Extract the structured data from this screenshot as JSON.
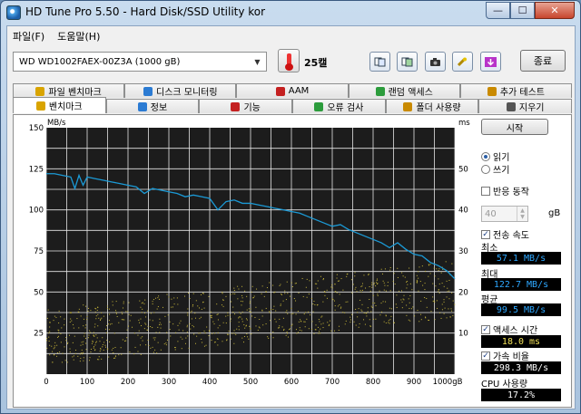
{
  "window": {
    "title": "HD Tune Pro 5.50 - Hard Disk/SSD Utility kor",
    "min": "—",
    "max": "☐",
    "close": "✕"
  },
  "menu": {
    "items": [
      "파일(F)",
      "도움말(H)"
    ]
  },
  "toolbar": {
    "drive": "WD    WD1002FAEX-00Z3A (1000 gB)",
    "temperature": "25캘",
    "exit_label": "종료",
    "buttons": [
      "copy-text-icon",
      "copy-image-icon",
      "screenshot-icon",
      "options-icon",
      "save-icon"
    ]
  },
  "tabs": {
    "top": [
      {
        "label": "파일 벤치마크",
        "icon": "file-benchmark-icon"
      },
      {
        "label": "디스크 모니터링",
        "icon": "disk-monitor-icon"
      },
      {
        "label": "AAM",
        "icon": "aam-icon"
      },
      {
        "label": "랜덤 액세스",
        "icon": "random-access-icon"
      },
      {
        "label": "추가 테스트",
        "icon": "extra-tests-icon"
      }
    ],
    "bottom": [
      {
        "label": "벤치마크",
        "icon": "benchmark-icon"
      },
      {
        "label": "정보",
        "icon": "info-icon"
      },
      {
        "label": "기능",
        "icon": "health-icon"
      },
      {
        "label": "오류 검사",
        "icon": "error-scan-icon"
      },
      {
        "label": "폴더 사용량",
        "icon": "folder-usage-icon"
      },
      {
        "label": "지우기",
        "icon": "erase-icon"
      }
    ]
  },
  "side": {
    "start_label": "시작",
    "read_label": "읽기",
    "write_label": "쓰기",
    "short_stroke_label": "반응 동작",
    "short_stroke_value": "40",
    "short_stroke_unit": "gB",
    "transfer_rate_label": "전송 속도",
    "min_label": "최소",
    "min_value": "57.1 MB/s",
    "max_label": "최대",
    "max_value": "122.7 MB/s",
    "avg_label": "평균",
    "avg_value": "99.5 MB/s",
    "access_time_label": "액세스 시간",
    "access_time_value": "18.0 ms",
    "burst_label": "가속 비율",
    "burst_value": "298.3 MB/s",
    "cpu_label": "CPU 사용량",
    "cpu_value": "17.2%"
  },
  "chart_data": {
    "type": "line",
    "left_axis_label": "MB/s",
    "right_axis_label": "ms",
    "x_unit": "gB",
    "xlim": [
      0,
      1000
    ],
    "ylim_left": [
      0,
      150
    ],
    "ylim_right": [
      0,
      60
    ],
    "x_ticks": [
      0,
      50,
      100,
      150,
      200,
      250,
      300,
      350,
      400,
      450,
      500,
      550,
      600,
      650,
      700,
      750,
      800,
      850,
      900,
      950,
      1000
    ],
    "x_tick_labels": [
      "0",
      "100",
      "200",
      "300",
      "400",
      "500",
      "600",
      "700",
      "800",
      "900",
      "1000gB"
    ],
    "y_left_ticks": [
      25,
      50,
      75,
      100,
      125,
      150
    ],
    "y_right_ticks": [
      10,
      20,
      30,
      40,
      50
    ],
    "transfer_rate": {
      "x": [
        0,
        20,
        40,
        60,
        70,
        80,
        90,
        100,
        120,
        140,
        160,
        180,
        200,
        220,
        240,
        260,
        280,
        300,
        320,
        340,
        360,
        380,
        400,
        420,
        440,
        460,
        480,
        500,
        520,
        540,
        560,
        580,
        600,
        620,
        640,
        660,
        680,
        700,
        720,
        740,
        760,
        780,
        800,
        820,
        840,
        860,
        880,
        900,
        920,
        940,
        960,
        980,
        1000
      ],
      "y": [
        122,
        122,
        121,
        120,
        113,
        121,
        115,
        120,
        119,
        118,
        117,
        116,
        115,
        114,
        110,
        113,
        112,
        111,
        110,
        108,
        109,
        108,
        107,
        100,
        105,
        106,
        104,
        104,
        103,
        102,
        101,
        100,
        99,
        98,
        96,
        94,
        92,
        90,
        91,
        88,
        86,
        84,
        82,
        80,
        77,
        80,
        76,
        73,
        72,
        68,
        66,
        63,
        58
      ]
    },
    "access_time_range_ms": [
      5,
      30
    ]
  },
  "colors": {
    "chart_bg": "#1c1c1c",
    "grid": "#e6e6e6",
    "line": "#1b9ad6",
    "dots": "#c9b83a"
  }
}
